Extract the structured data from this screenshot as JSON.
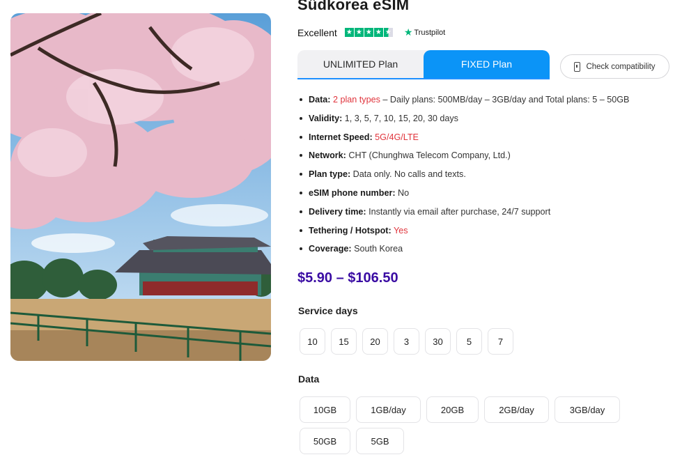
{
  "product": {
    "title": "Südkorea eSIM",
    "rating_word": "Excellent",
    "rating_stars": 4.5,
    "trustpilot_label": "Trustpilot"
  },
  "tabs": [
    {
      "label": "UNLIMITED Plan",
      "active": false
    },
    {
      "label": "FIXED Plan",
      "active": true
    }
  ],
  "compat_button": {
    "label": "Check compatibility",
    "icon": "phone-icon"
  },
  "features": {
    "data_label": "Data:",
    "data_highlight": "2 plan types",
    "data_rest": " – Daily plans: 500MB/day – 3GB/day and Total plans: 5 – 50GB",
    "validity_label": "Validity:",
    "validity_value": " 1, 3, 5, 7, 10, 15, 20, 30 days",
    "speed_label": "Internet Speed:",
    "speed_value": " 5G/4G/LTE",
    "network_label": "Network:",
    "network_value": " CHT (Chunghwa Telecom Company, Ltd.)",
    "plantype_label": "Plan type:",
    "plantype_value": " Data only. No calls and  texts.",
    "phone_label": "eSIM phone number:",
    "phone_value": " No",
    "delivery_label": "Delivery time:",
    "delivery_value": " Instantly via email after purchase, 24/7 support",
    "tethering_label": "Tethering / Hotspot:",
    "tethering_value": " Yes",
    "coverage_label": "Coverage:",
    "coverage_value": " South Korea"
  },
  "price": "$5.90 – $106.50",
  "service_days": {
    "label": "Service days",
    "options": [
      "10",
      "15",
      "20",
      "3",
      "30",
      "5",
      "7"
    ]
  },
  "data_options": {
    "label": "Data",
    "row1": [
      "10GB",
      "1GB/day",
      "20GB",
      "2GB/day",
      "3GB/day"
    ],
    "row2": [
      "50GB",
      "5GB"
    ]
  },
  "colors": {
    "accent_blue": "#0b94f7",
    "price_purple": "#3a0ca3",
    "highlight_red": "#e0343c",
    "trustpilot_green": "#00b67a"
  }
}
